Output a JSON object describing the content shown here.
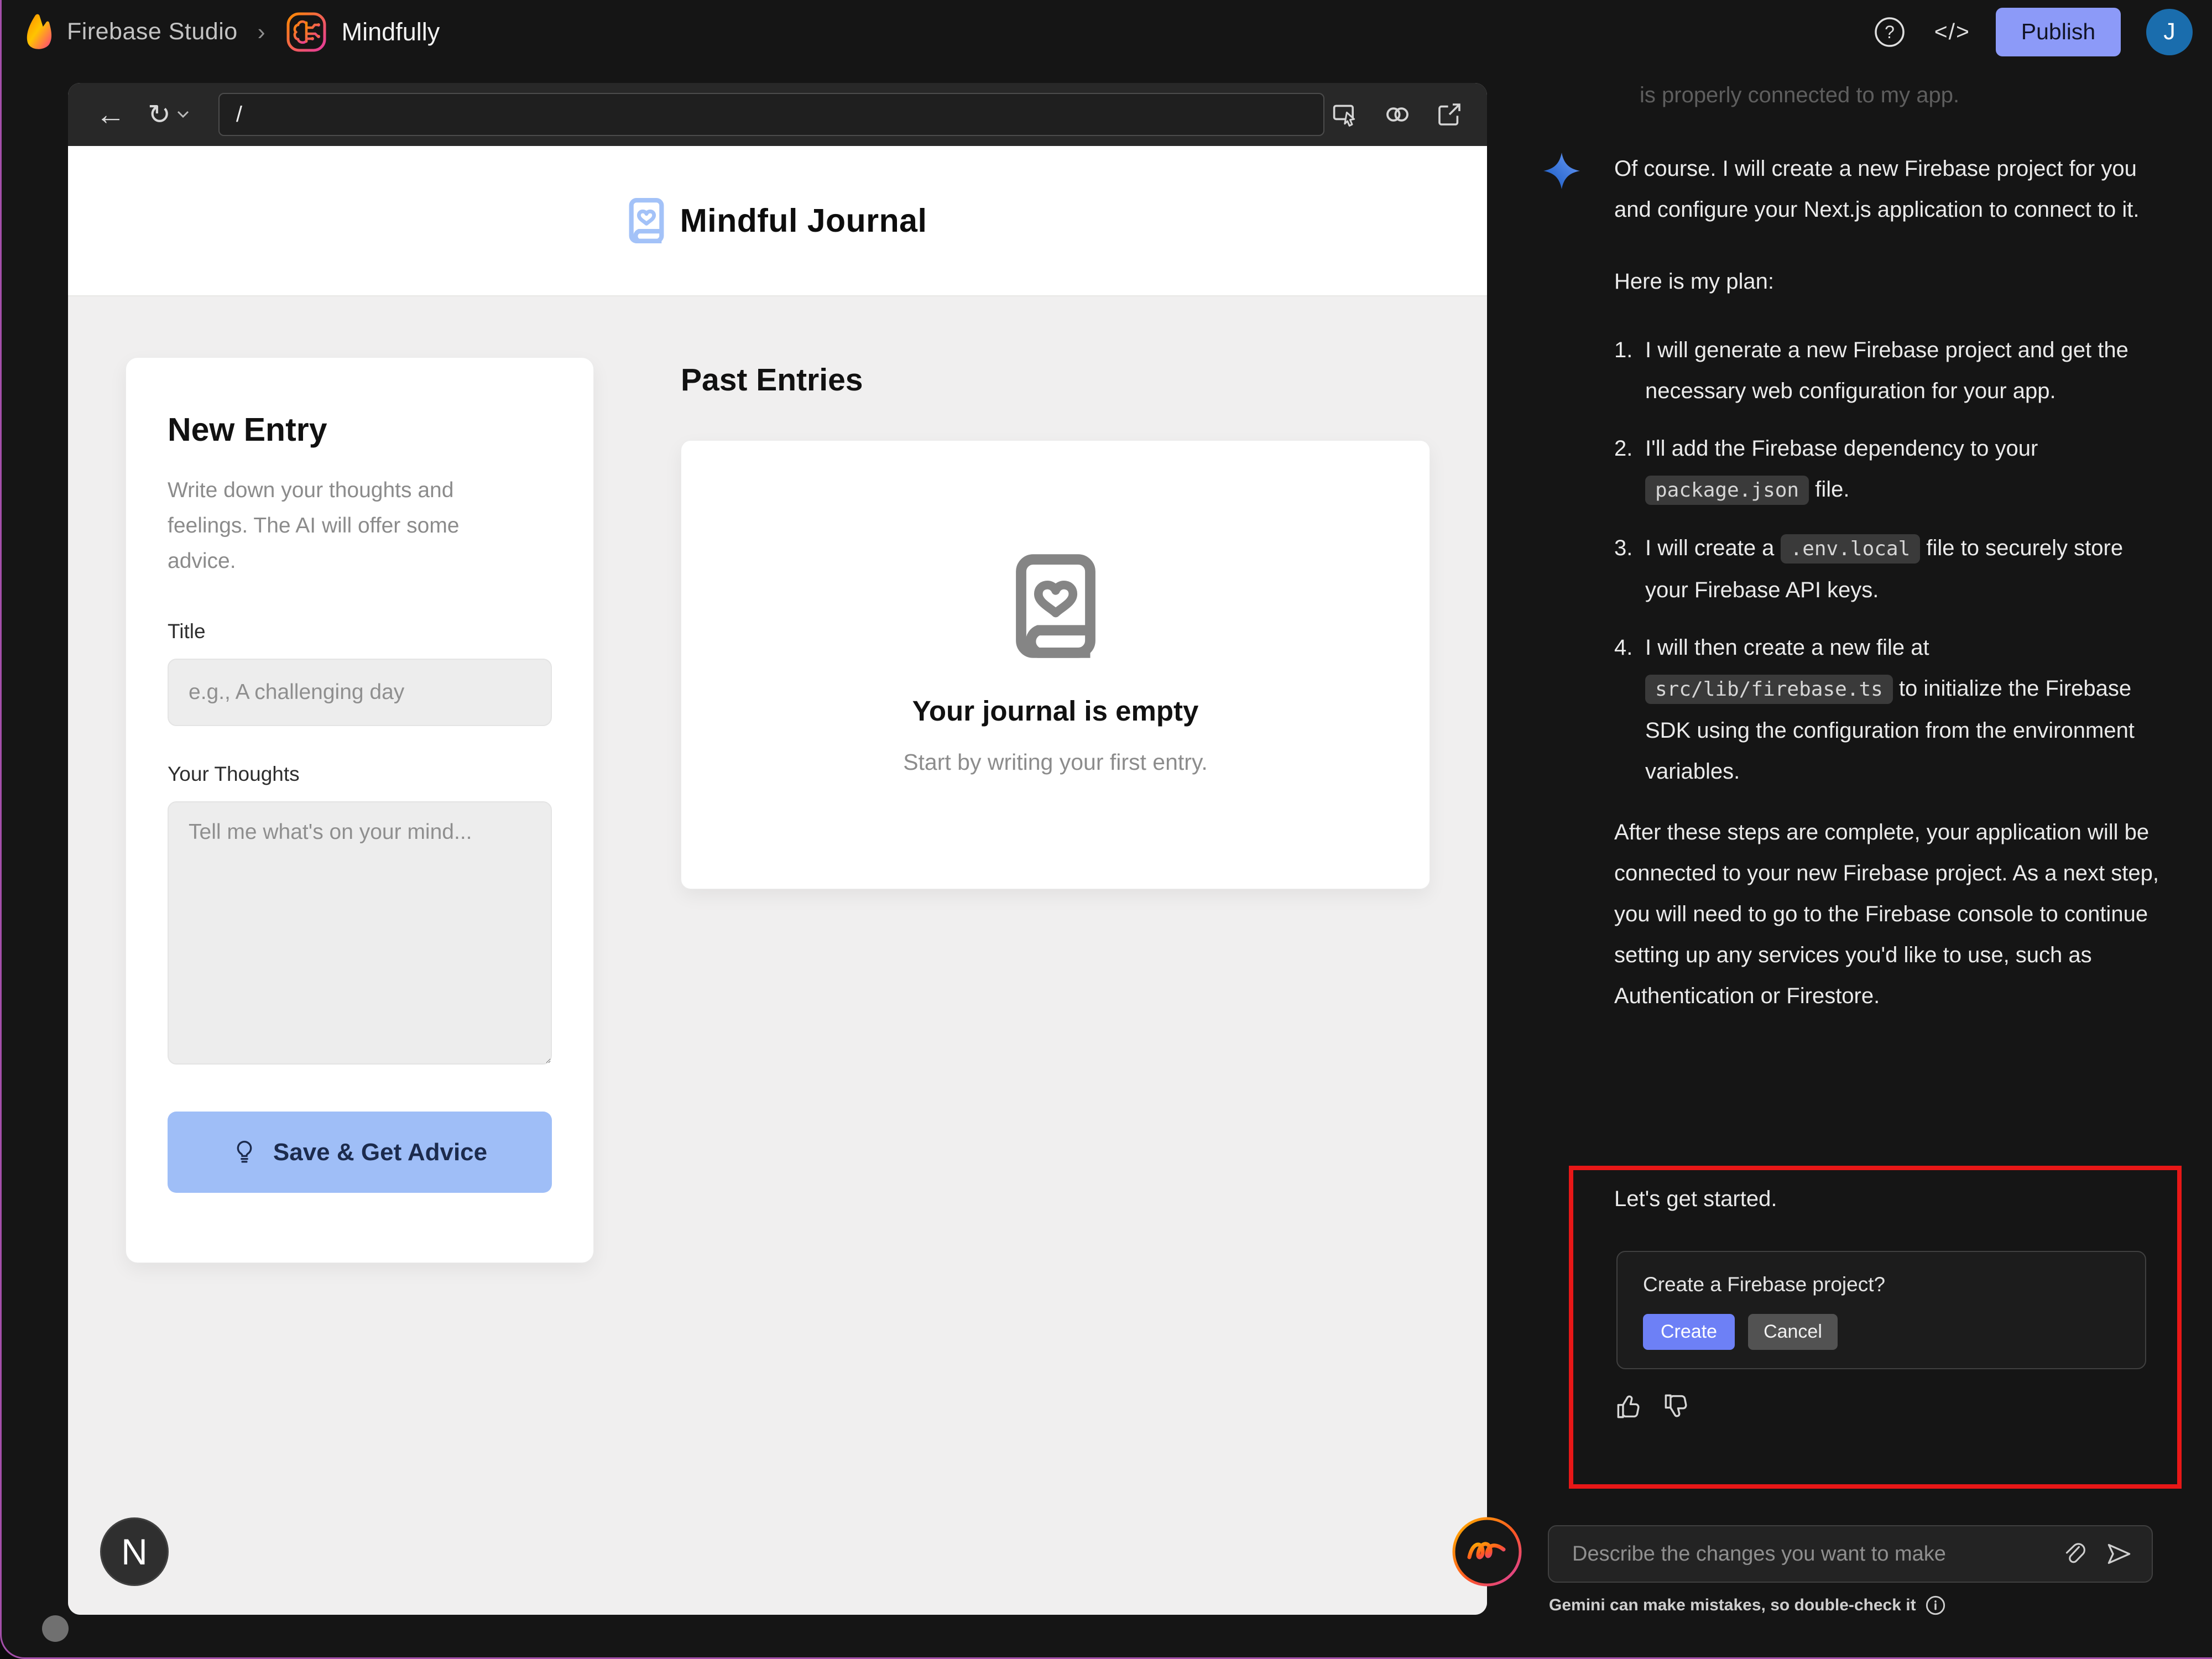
{
  "header": {
    "app_name": "Firebase Studio",
    "breadcrumb_separator": "›",
    "project_name": "Mindfully",
    "code_label": "</>",
    "publish_label": "Publish",
    "avatar_initial": "J"
  },
  "preview": {
    "url_value": "/",
    "nextjs_badge": "N",
    "app": {
      "title": "Mindful Journal",
      "new_entry": {
        "heading": "New Entry",
        "description": "Write down your thoughts and feelings. The AI will offer some advice.",
        "title_label": "Title",
        "title_placeholder": "e.g., A challenging day",
        "thoughts_label": "Your Thoughts",
        "thoughts_placeholder": "Tell me what's on your mind...",
        "save_button": "Save & Get Advice"
      },
      "past_entries": {
        "heading": "Past Entries",
        "empty_title": "Your journal is empty",
        "empty_subtitle": "Start by writing your first entry."
      }
    }
  },
  "chat": {
    "clipped_line": "is properly connected to my app.",
    "intro": "Of course. I will create a new Firebase project for you and configure your Next.js application to connect to it.",
    "plan_heading": "Here is my plan:",
    "plan": [
      {
        "num": "1.",
        "pre": "I will generate a new Firebase project and get the necessary web configuration for your app.",
        "code": "",
        "post": ""
      },
      {
        "num": "2.",
        "pre": "I'll add the Firebase dependency to your ",
        "code": "package.json",
        "post": " file."
      },
      {
        "num": "3.",
        "pre": "I will create a ",
        "code": ".env.local",
        "post": " file to securely store your Firebase API keys."
      },
      {
        "num": "4.",
        "pre": "I will then create a new file at ",
        "code": "src/lib/firebase.ts",
        "post": " to initialize the Firebase SDK using the configuration from the environment variables."
      }
    ],
    "outro": "After these steps are complete, your application will be connected to your new Firebase project. As a next step, you will need to go to the Firebase console to continue setting up any services you'd like to use, such as Authentication or Firestore.",
    "cta": "Let's get started.",
    "tool_card": {
      "question": "Create a Firebase project?",
      "create_label": "Create",
      "cancel_label": "Cancel"
    },
    "input_placeholder": "Describe the changes you want to make",
    "disclaimer": "Gemini can make mistakes, so double-check it"
  },
  "colors": {
    "publish_button": "#8c9af8",
    "create_button": "#6d80f6",
    "save_button": "#9fbef7",
    "avatar": "#1a6dad",
    "annotation_box": "#e81717",
    "sparkle_blue": "#4b7fe8"
  },
  "icons": {
    "flame-icon": "firebase flame",
    "brain-circuit-icon": "mindfully project logo",
    "book-heart-icon": "journal book with heart",
    "sparkle-icon": "gemini sparkle",
    "thumb-up-icon": "rate good",
    "thumb-down-icon": "rate bad",
    "paperclip-icon": "attach file",
    "send-icon": "send message",
    "info-icon": "information"
  }
}
